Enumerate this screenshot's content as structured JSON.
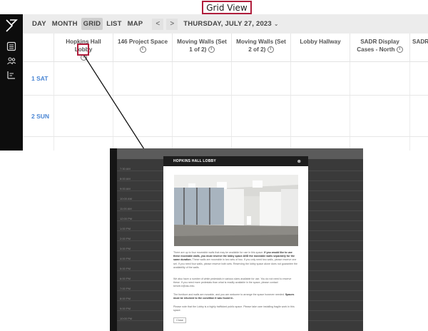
{
  "caption": "Grid View",
  "sidebar": {
    "icons": [
      "logo-icon",
      "list-icon",
      "people-icon",
      "events-icon"
    ]
  },
  "toolbar": {
    "views": [
      "DAY",
      "MONTH",
      "GRID",
      "LIST",
      "MAP"
    ],
    "active_view": "GRID",
    "prev": "<",
    "next": ">",
    "date": "THURSDAY, JULY 27, 2023",
    "chevron": "⌄"
  },
  "columns": [
    {
      "name": "Hopkins Hall Lobby"
    },
    {
      "name": "146 Project Space"
    },
    {
      "name": "Moving Walls (Set 1 of 2)"
    },
    {
      "name": "Moving Walls (Set 2 of 2)"
    },
    {
      "name": "Lobby Hallway"
    },
    {
      "name": "SADR Display Cases - North"
    },
    {
      "name": "SADR D S"
    }
  ],
  "days": [
    "1 SAT",
    "2 SUN"
  ],
  "inset": {
    "modal_title": "HOPKINS HALL LOBBY",
    "close_x": "⊗",
    "para1_a": "There are up to four moveable walls that may be available for use in this space. ",
    "para1_b": "If you would like to use these moveable walls, you must reserve the lobby space AND the moveable walls separately for the same duration.",
    "para1_c": " These walls are moveable in two sets of two. If you only need two walls, please reserve one set. If you need four walls, please reserve both sets. Reserving the lobby space alone does not guarantee the availability of the walls.",
    "para2": "We also have a number of white pedestals in various sizes available for use. You do not need to reserve these. If you need more pedestals than what is readily available in the space, please contact kenvin.ii@osu.edu.",
    "para3_a": "The furniture and walls are movable, and you are welcome to arrange the space however needed. ",
    "para3_b": "Spaces must be returned to the condition it was found in.",
    "para4": "Please note that the Lobby is a highly trafficked public space. Please take care installing fragile work in this space.",
    "close_label": "Close",
    "times": [
      "7:30 AM",
      "8:00 AM",
      "9:00 AM",
      "10:00 AM",
      "11:00 AM",
      "12:00 PM",
      "1:00 PM",
      "2:00 PM",
      "3:00 PM",
      "4:00 PM",
      "5:00 PM",
      "6:00 PM",
      "7:00 PM",
      "8:00 PM",
      "9:00 PM",
      "10:00 PM"
    ]
  }
}
